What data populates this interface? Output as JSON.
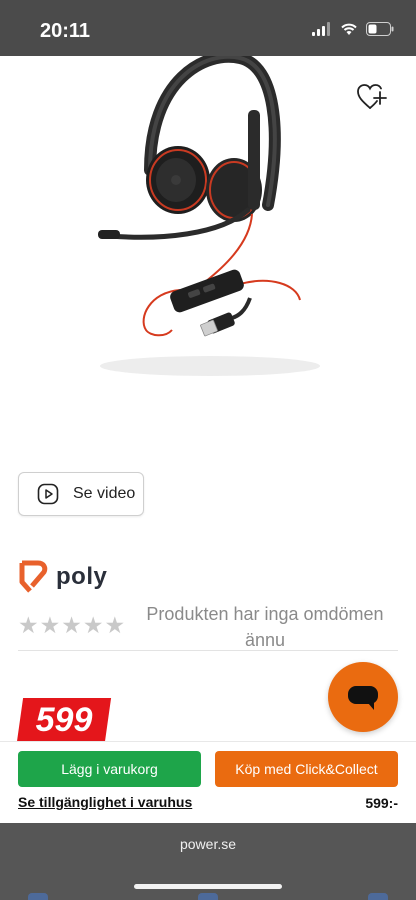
{
  "status_bar": {
    "time": "20:11"
  },
  "product": {
    "image_alt": "Poly Blackwire headset with USB cable",
    "wishlist_icon": "heart-plus-icon",
    "video_label": "Se video",
    "brand_name": "poly",
    "rating_stars": 0,
    "rating_max": 5,
    "review_text": "Produkten har inga omdömen ännu",
    "price": "599"
  },
  "actions": {
    "add_to_cart_label": "Lägg i varukorg",
    "click_collect_label": "Köp med Click&Collect",
    "store_availability_label": "Se tillgänglighet i varuhus",
    "small_price": "599:-"
  },
  "browser": {
    "url": "power.se"
  },
  "colors": {
    "accent_green": "#1ea54a",
    "accent_orange": "#ea6b10",
    "price_red": "#e4161b",
    "brand_logo": "#e8612c"
  }
}
